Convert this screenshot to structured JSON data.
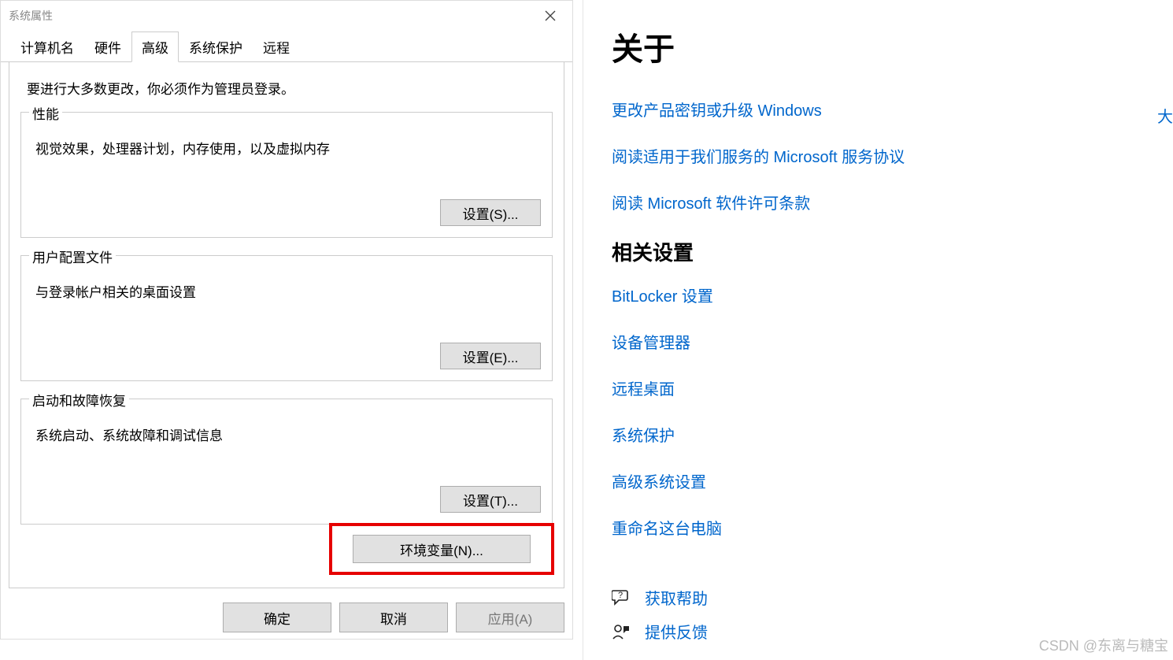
{
  "dialog": {
    "title": "系统属性",
    "tabs": [
      "计算机名",
      "硬件",
      "高级",
      "系统保护",
      "远程"
    ],
    "activeTab": 2,
    "intro": "要进行大多数更改，你必须作为管理员登录。",
    "groups": [
      {
        "legend": "性能",
        "desc": "视觉效果，处理器计划，内存使用，以及虚拟内存",
        "btn": "设置(S)..."
      },
      {
        "legend": "用户配置文件",
        "desc": "与登录帐户相关的桌面设置",
        "btn": "设置(E)..."
      },
      {
        "legend": "启动和故障恢复",
        "desc": "系统启动、系统故障和调试信息",
        "btn": "设置(T)..."
      }
    ],
    "envBtn": "环境变量(N)...",
    "footer": {
      "ok": "确定",
      "cancel": "取消",
      "apply": "应用(A)"
    }
  },
  "settings": {
    "heading": "关于",
    "links1": [
      "更改产品密钥或升级 Windows",
      "阅读适用于我们服务的 Microsoft 服务协议",
      "阅读 Microsoft 软件许可条款"
    ],
    "relatedHeading": "相关设置",
    "links2": [
      "BitLocker 设置",
      "设备管理器",
      "远程桌面",
      "系统保护",
      "高级系统设置",
      "重命名这台电脑"
    ],
    "help": {
      "getHelp": "获取帮助",
      "feedback": "提供反馈"
    }
  },
  "watermark": "CSDN @东离与糖宝",
  "cutChar": "大"
}
